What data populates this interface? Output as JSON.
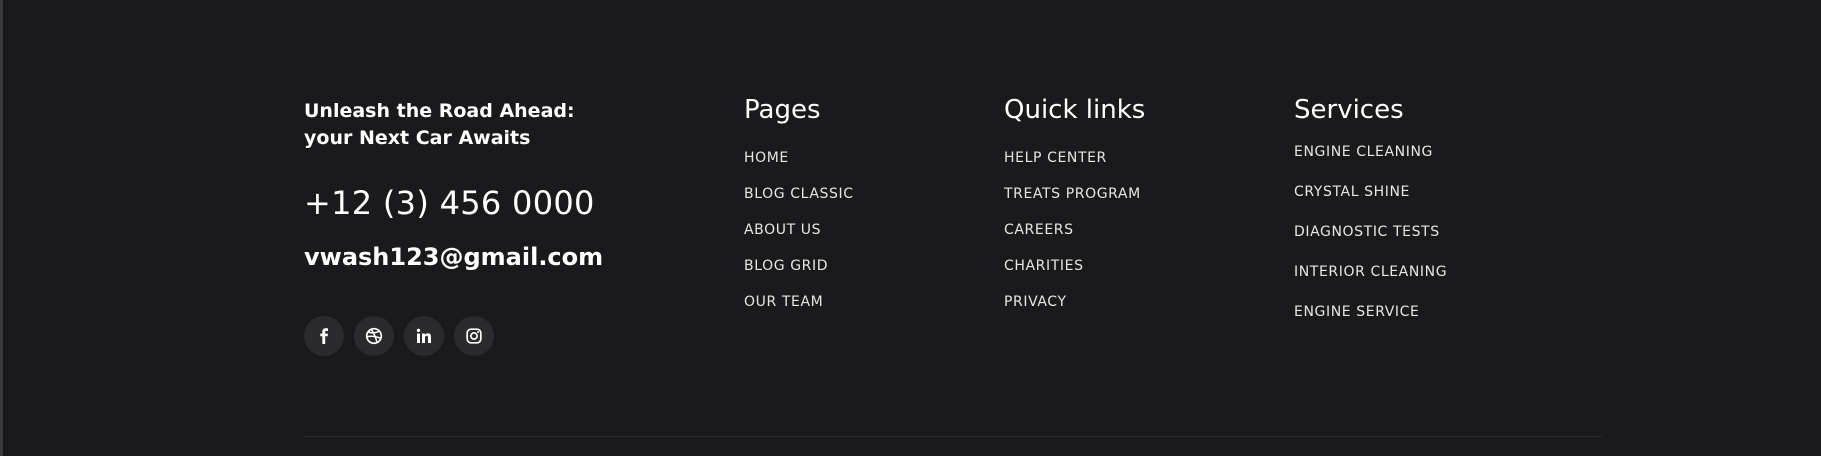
{
  "brand": {
    "tagline_line1": "Unleash the Road Ahead:",
    "tagline_line2": "your Next Car Awaits",
    "phone": "+12 (3) 456 0000",
    "email": "vwash123@gmail.com"
  },
  "socials": [
    {
      "icon": "facebook-icon"
    },
    {
      "icon": "dribbble-icon"
    },
    {
      "icon": "linkedin-icon"
    },
    {
      "icon": "instagram-icon"
    }
  ],
  "pages": {
    "title": "Pages",
    "items": [
      "HOME",
      "BLOG CLASSIC",
      "ABOUT US",
      "BLOG GRID",
      "OUR TEAM"
    ]
  },
  "quick_links": {
    "title": "Quick links",
    "items": [
      "HELP CENTER",
      "TREATS PROGRAM",
      "CAREERS",
      "CHARITIES",
      "PRIVACY"
    ]
  },
  "services": {
    "title": "Services",
    "items": [
      "ENGINE CLEANING",
      "CRYSTAL SHINE",
      "DIAGNOSTIC TESTS",
      "INTERIOR CLEANING",
      "ENGINE SERVICE"
    ]
  },
  "colors": {
    "background": "#1a1a1c",
    "social_circle": "#2b2b2e",
    "text": "#ffffff",
    "link_text": "#e6e6e6"
  }
}
